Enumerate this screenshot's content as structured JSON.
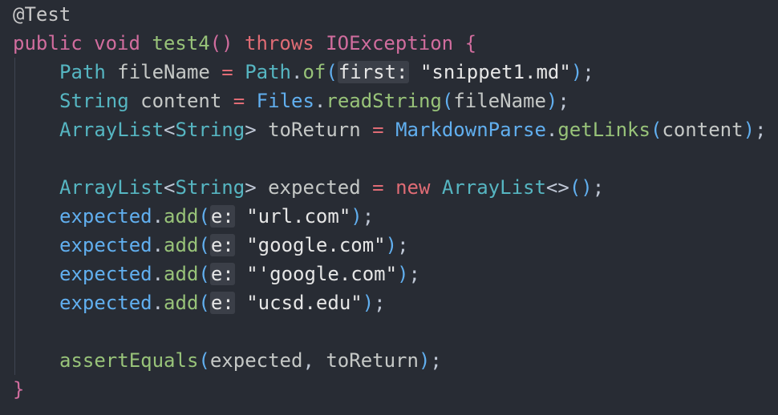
{
  "lines": [
    {
      "tokens": [
        {
          "t": "@Test",
          "c": "anno"
        }
      ]
    },
    {
      "tokens": [
        {
          "t": "public",
          "c": "kw"
        },
        {
          "t": " ",
          "c": "sp"
        },
        {
          "t": "void",
          "c": "kw"
        },
        {
          "t": " ",
          "c": "sp"
        },
        {
          "t": "test4",
          "c": "fn"
        },
        {
          "t": "()",
          "c": "kw"
        },
        {
          "t": " ",
          "c": "sp"
        },
        {
          "t": "throws",
          "c": "kw2"
        },
        {
          "t": " ",
          "c": "sp"
        },
        {
          "t": "IOException",
          "c": "kw"
        },
        {
          "t": " ",
          "c": "sp"
        },
        {
          "t": "{",
          "c": "kw"
        }
      ]
    },
    {
      "indent": 1,
      "tokens": [
        {
          "t": "Path",
          "c": "ty"
        },
        {
          "t": " ",
          "c": "sp"
        },
        {
          "t": "fileName",
          "c": "var"
        },
        {
          "t": " ",
          "c": "sp"
        },
        {
          "t": "=",
          "c": "op"
        },
        {
          "t": " ",
          "c": "sp"
        },
        {
          "t": "Path",
          "c": "ty"
        },
        {
          "t": ".",
          "c": "punc"
        },
        {
          "t": "of",
          "c": "fn"
        },
        {
          "t": "(",
          "c": "paren"
        },
        {
          "t": "first:",
          "c": "hint"
        },
        {
          "t": " ",
          "c": "sp"
        },
        {
          "t": "\"snippet1.md\"",
          "c": "str"
        },
        {
          "t": ")",
          "c": "paren"
        },
        {
          "t": ";",
          "c": "punc"
        }
      ]
    },
    {
      "indent": 1,
      "tokens": [
        {
          "t": "String",
          "c": "ty"
        },
        {
          "t": " ",
          "c": "sp"
        },
        {
          "t": "content",
          "c": "var"
        },
        {
          "t": " ",
          "c": "sp"
        },
        {
          "t": "=",
          "c": "op"
        },
        {
          "t": " ",
          "c": "sp"
        },
        {
          "t": "Files",
          "c": "fn2"
        },
        {
          "t": ".",
          "c": "punc"
        },
        {
          "t": "readString",
          "c": "fn"
        },
        {
          "t": "(",
          "c": "paren"
        },
        {
          "t": "fileName",
          "c": "var"
        },
        {
          "t": ")",
          "c": "paren"
        },
        {
          "t": ";",
          "c": "punc"
        }
      ]
    },
    {
      "indent": 1,
      "tokens": [
        {
          "t": "ArrayList",
          "c": "ty"
        },
        {
          "t": "<",
          "c": "punc"
        },
        {
          "t": "String",
          "c": "ty"
        },
        {
          "t": ">",
          "c": "punc"
        },
        {
          "t": " ",
          "c": "sp"
        },
        {
          "t": "toReturn",
          "c": "var"
        },
        {
          "t": " ",
          "c": "sp"
        },
        {
          "t": "=",
          "c": "op"
        },
        {
          "t": " ",
          "c": "sp"
        },
        {
          "t": "MarkdownParse",
          "c": "fn2"
        },
        {
          "t": ".",
          "c": "punc"
        },
        {
          "t": "getLinks",
          "c": "fn"
        },
        {
          "t": "(",
          "c": "paren"
        },
        {
          "t": "content",
          "c": "var"
        },
        {
          "t": ")",
          "c": "paren"
        },
        {
          "t": ";",
          "c": "punc"
        }
      ]
    },
    {
      "indent": 1,
      "tokens": []
    },
    {
      "indent": 1,
      "tokens": [
        {
          "t": "ArrayList",
          "c": "ty"
        },
        {
          "t": "<",
          "c": "punc"
        },
        {
          "t": "String",
          "c": "ty"
        },
        {
          "t": ">",
          "c": "punc"
        },
        {
          "t": " ",
          "c": "sp"
        },
        {
          "t": "expected",
          "c": "var"
        },
        {
          "t": " ",
          "c": "sp"
        },
        {
          "t": "=",
          "c": "op"
        },
        {
          "t": " ",
          "c": "sp"
        },
        {
          "t": "new",
          "c": "kw2"
        },
        {
          "t": " ",
          "c": "sp"
        },
        {
          "t": "ArrayList",
          "c": "ty"
        },
        {
          "t": "<>",
          "c": "punc"
        },
        {
          "t": "()",
          "c": "paren"
        },
        {
          "t": ";",
          "c": "punc"
        }
      ]
    },
    {
      "indent": 1,
      "tokens": [
        {
          "t": "expected",
          "c": "fn2"
        },
        {
          "t": ".",
          "c": "punc"
        },
        {
          "t": "add",
          "c": "fn"
        },
        {
          "t": "(",
          "c": "paren"
        },
        {
          "t": "e:",
          "c": "hint"
        },
        {
          "t": " ",
          "c": "sp"
        },
        {
          "t": "\"url.com\"",
          "c": "str"
        },
        {
          "t": ")",
          "c": "paren"
        },
        {
          "t": ";",
          "c": "punc"
        }
      ]
    },
    {
      "indent": 1,
      "tokens": [
        {
          "t": "expected",
          "c": "fn2"
        },
        {
          "t": ".",
          "c": "punc"
        },
        {
          "t": "add",
          "c": "fn"
        },
        {
          "t": "(",
          "c": "paren"
        },
        {
          "t": "e:",
          "c": "hint"
        },
        {
          "t": " ",
          "c": "sp"
        },
        {
          "t": "\"google.com\"",
          "c": "str"
        },
        {
          "t": ")",
          "c": "paren"
        },
        {
          "t": ";",
          "c": "punc"
        }
      ]
    },
    {
      "indent": 1,
      "tokens": [
        {
          "t": "expected",
          "c": "fn2"
        },
        {
          "t": ".",
          "c": "punc"
        },
        {
          "t": "add",
          "c": "fn"
        },
        {
          "t": "(",
          "c": "paren"
        },
        {
          "t": "e:",
          "c": "hint"
        },
        {
          "t": " ",
          "c": "sp"
        },
        {
          "t": "\"'google.com\"",
          "c": "str"
        },
        {
          "t": ")",
          "c": "paren"
        },
        {
          "t": ";",
          "c": "punc"
        }
      ]
    },
    {
      "indent": 1,
      "tokens": [
        {
          "t": "expected",
          "c": "fn2"
        },
        {
          "t": ".",
          "c": "punc"
        },
        {
          "t": "add",
          "c": "fn"
        },
        {
          "t": "(",
          "c": "paren"
        },
        {
          "t": "e:",
          "c": "hint"
        },
        {
          "t": " ",
          "c": "sp"
        },
        {
          "t": "\"ucsd.edu\"",
          "c": "str"
        },
        {
          "t": ")",
          "c": "paren"
        },
        {
          "t": ";",
          "c": "punc"
        }
      ]
    },
    {
      "indent": 1,
      "tokens": []
    },
    {
      "indent": 1,
      "tokens": [
        {
          "t": "assertEquals",
          "c": "fn"
        },
        {
          "t": "(",
          "c": "paren"
        },
        {
          "t": "expected",
          "c": "var"
        },
        {
          "t": ",",
          "c": "punc"
        },
        {
          "t": " ",
          "c": "sp"
        },
        {
          "t": "toReturn",
          "c": "var"
        },
        {
          "t": ")",
          "c": "paren"
        },
        {
          "t": ";",
          "c": "punc"
        }
      ]
    },
    {
      "tokens": [
        {
          "t": "}",
          "c": "kw"
        }
      ]
    }
  ]
}
